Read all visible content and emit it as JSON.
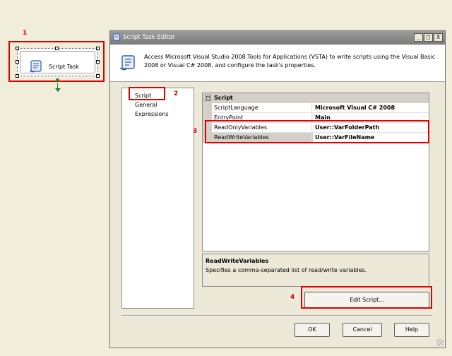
{
  "annotations": {
    "a1": "1",
    "a2": "2",
    "a3": "3",
    "a4": "4"
  },
  "task": {
    "label": "Script Task",
    "icon": "script-icon"
  },
  "window": {
    "title": "Script Task Editor",
    "minimize": "_",
    "maximize": "□",
    "close": "X"
  },
  "header": {
    "description": "Access Microsoft Visual Studio 2008 Tools for Applications (VSTA) to write scripts using the Visual Basic 2008 or Visual C# 2008, and configure the task's properties.",
    "icon": "script-icon"
  },
  "nav": {
    "items": [
      {
        "label": "Script",
        "selected": true
      },
      {
        "label": "General"
      },
      {
        "label": "Expressions"
      }
    ]
  },
  "grid": {
    "category": "Script",
    "expander": "⊟",
    "rows": [
      {
        "name": "ScriptLanguage",
        "value": "Microsoft Visual C# 2008"
      },
      {
        "name": "EntryPoint",
        "value": "Main"
      },
      {
        "name": "ReadOnlyVariables",
        "value": "User::VarFolderPath"
      },
      {
        "name": "ReadWriteVariables",
        "value": "User::VarFileName"
      }
    ]
  },
  "description": {
    "title": "ReadWriteVariables",
    "text": "Specifies a comma-separated list of read/write variables."
  },
  "buttons": {
    "edit_script": "Edit Script...",
    "ok": "OK",
    "cancel": "Cancel",
    "help": "Help"
  },
  "colors": {
    "annotation": "#e00000",
    "title_bar": "#8a8a8a",
    "connector": "#2d7a2d"
  }
}
